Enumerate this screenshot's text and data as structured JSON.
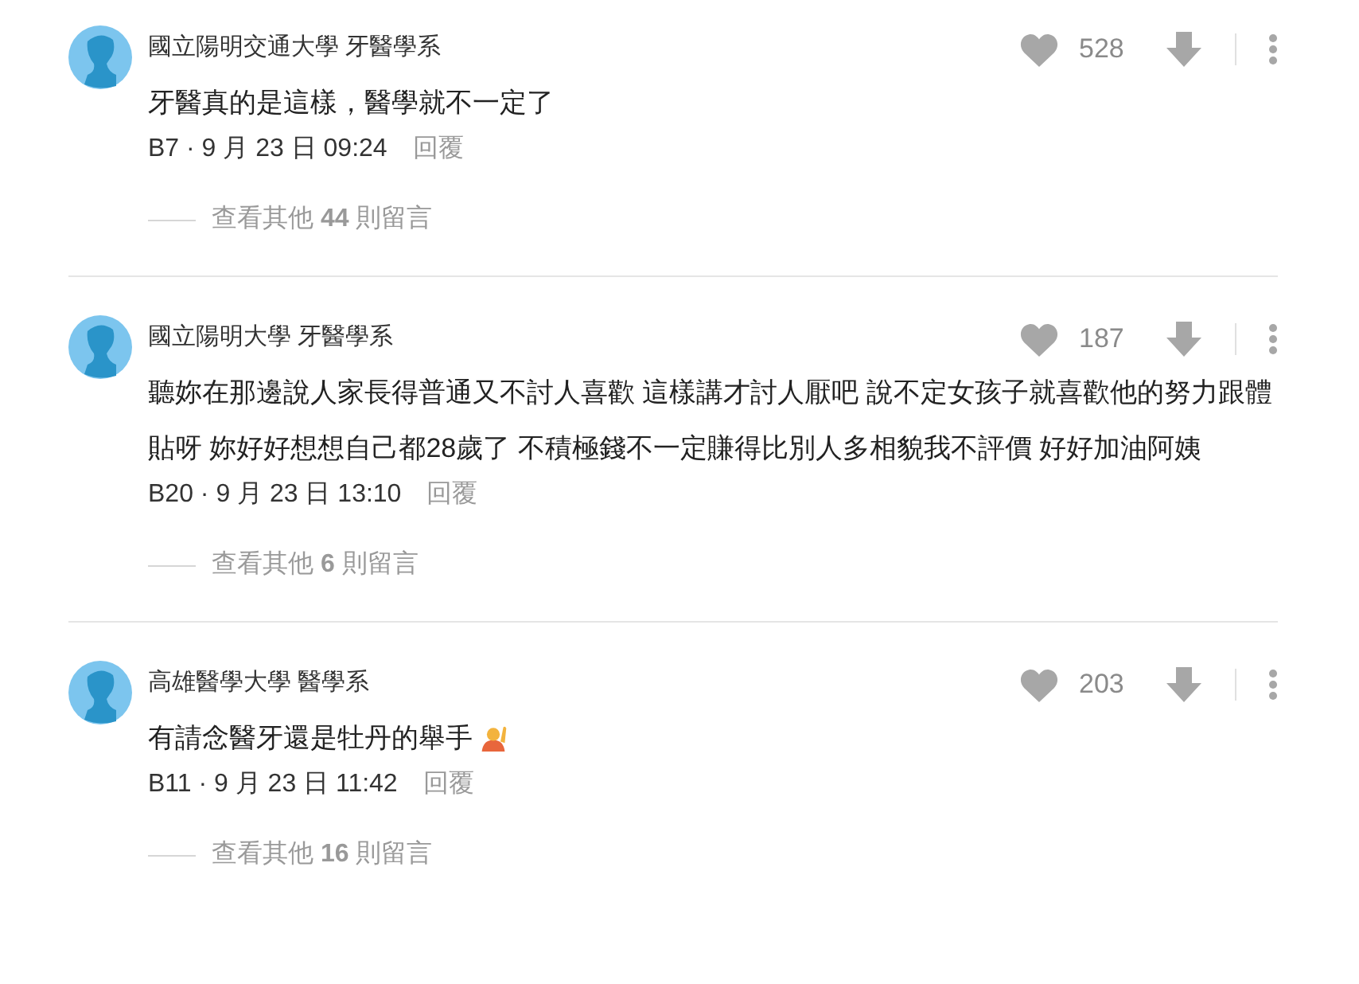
{
  "comments": [
    {
      "author": "國立陽明交通大學 牙醫學系",
      "body": "牙醫真的是這樣，醫學就不一定了",
      "emoji": false,
      "meta": "B7 · 9 月 23 日 09:24",
      "reply": "回覆",
      "likes": "528",
      "more_replies": "查看其他 **44** 則留言"
    },
    {
      "author": "國立陽明大學 牙醫學系",
      "body": "聽妳在那邊說人家長得普通又不討人喜歡 這樣講才討人厭吧 說不定女孩子就喜歡他的努力跟體貼呀 妳好好想想自己都28歲了 不積極錢不一定賺得比別人多相貌我不評價 好好加油阿姨",
      "emoji": false,
      "meta": "B20 · 9 月 23 日 13:10",
      "reply": "回覆",
      "likes": "187",
      "more_replies": "查看其他 **6** 則留言"
    },
    {
      "author": "高雄醫學大學 醫學系",
      "body": "有請念醫牙還是牡丹的舉手",
      "emoji": true,
      "meta": "B11 · 9 月 23 日 11:42",
      "reply": "回覆",
      "likes": "203",
      "more_replies": "查看其他 **16** 則留言"
    }
  ]
}
